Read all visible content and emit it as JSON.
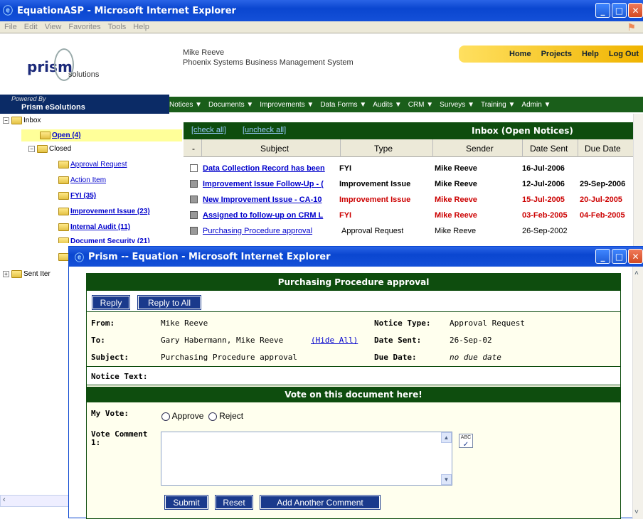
{
  "main_window": {
    "title": "EquationASP - Microsoft Internet Explorer",
    "menu": [
      "File",
      "Edit",
      "View",
      "Favorites",
      "Tools",
      "Help"
    ]
  },
  "header": {
    "logo_text": "prism",
    "logo_sub": "solutions",
    "user_name": "Mike Reeve",
    "system_name": "Phoenix Systems Business Management System",
    "top_links": [
      "Home",
      "Projects",
      "Help",
      "Log Out"
    ],
    "powered_by": "Powered By",
    "powered_name": "Prism eSolutions"
  },
  "nav": [
    "Notices ▼",
    "Documents ▼",
    "Improvements ▼",
    "Data Forms ▼",
    "Audits ▼",
    "CRM ▼",
    "Surveys ▼",
    "Training ▼",
    "Admin ▼"
  ],
  "tree": {
    "inbox": "Inbox",
    "open": "Open (4)",
    "closed": "Closed",
    "approval": "Approval Request",
    "action": "Action Item",
    "fyi": "FYI (35)",
    "improvement": "Improvement Issue (23)",
    "internal_audit": "Internal Audit (11)",
    "doc_security": "Document Security (21)",
    "sent": "Sent Iter"
  },
  "inbox": {
    "check_all": "[check all]",
    "uncheck_all": "[uncheck all]",
    "title": "Inbox (Open Notices)",
    "columns": [
      "-",
      "Subject",
      "Type",
      "Sender",
      "Date Sent",
      "Due Date"
    ],
    "rows": [
      {
        "subject": "Data Collection Record has been",
        "type": "FYI",
        "sender": "Mike Reeve",
        "sent": "16-Jul-2006",
        "due": ""
      },
      {
        "subject": "Improvement Issue Follow-Up - (",
        "type": "Improvement Issue",
        "sender": "Mike Reeve",
        "sent": "12-Jul-2006",
        "due": "29-Sep-2006"
      },
      {
        "subject": "New Improvement Issue - CA-10",
        "type": "Improvement Issue",
        "sender": "Mike Reeve",
        "sent": "15-Jul-2005",
        "due": "20-Jul-2005"
      },
      {
        "subject": "Assigned to follow-up on CRM L",
        "type": "FYI",
        "sender": "Mike Reeve",
        "sent": "03-Feb-2005",
        "due": "04-Feb-2005"
      },
      {
        "subject": "Purchasing Procedure approval",
        "type": "Approval Request",
        "sender": "Mike Reeve",
        "sent": "26-Sep-2002",
        "due": ""
      }
    ]
  },
  "popup": {
    "title": "Prism -- Equation - Microsoft Internet Explorer",
    "header": "Purchasing Procedure approval",
    "reply": "Reply",
    "reply_all": "Reply to All",
    "from_label": "From:",
    "from_value": "Mike Reeve",
    "to_label": "To:",
    "to_value": "Gary Habermann, Mike Reeve",
    "hide_all": "(Hide All)",
    "subject_label": "Subject:",
    "subject_value": "Purchasing Procedure approval",
    "type_label": "Notice Type:",
    "type_value": "Approval Request",
    "sent_label": "Date Sent:",
    "sent_value": "26-Sep-02",
    "due_label": "Due Date:",
    "due_value": "no due date",
    "notice_text_label": "Notice Text:",
    "vote_header": "Vote on this document here!",
    "my_vote_label": "My Vote:",
    "approve": "Approve",
    "reject": "Reject",
    "comment_label": "Vote Comment 1:",
    "submit": "Submit",
    "reset": "Reset",
    "add_comment": "Add Another Comment",
    "spell_icon_text": "ABC"
  },
  "colors": {
    "title_blue": "#0a46d0",
    "dark_green": "#0e4d0e",
    "link_blue": "#0000cc",
    "urgent_red": "#cc0000",
    "button_blue": "#1a3a8c"
  }
}
